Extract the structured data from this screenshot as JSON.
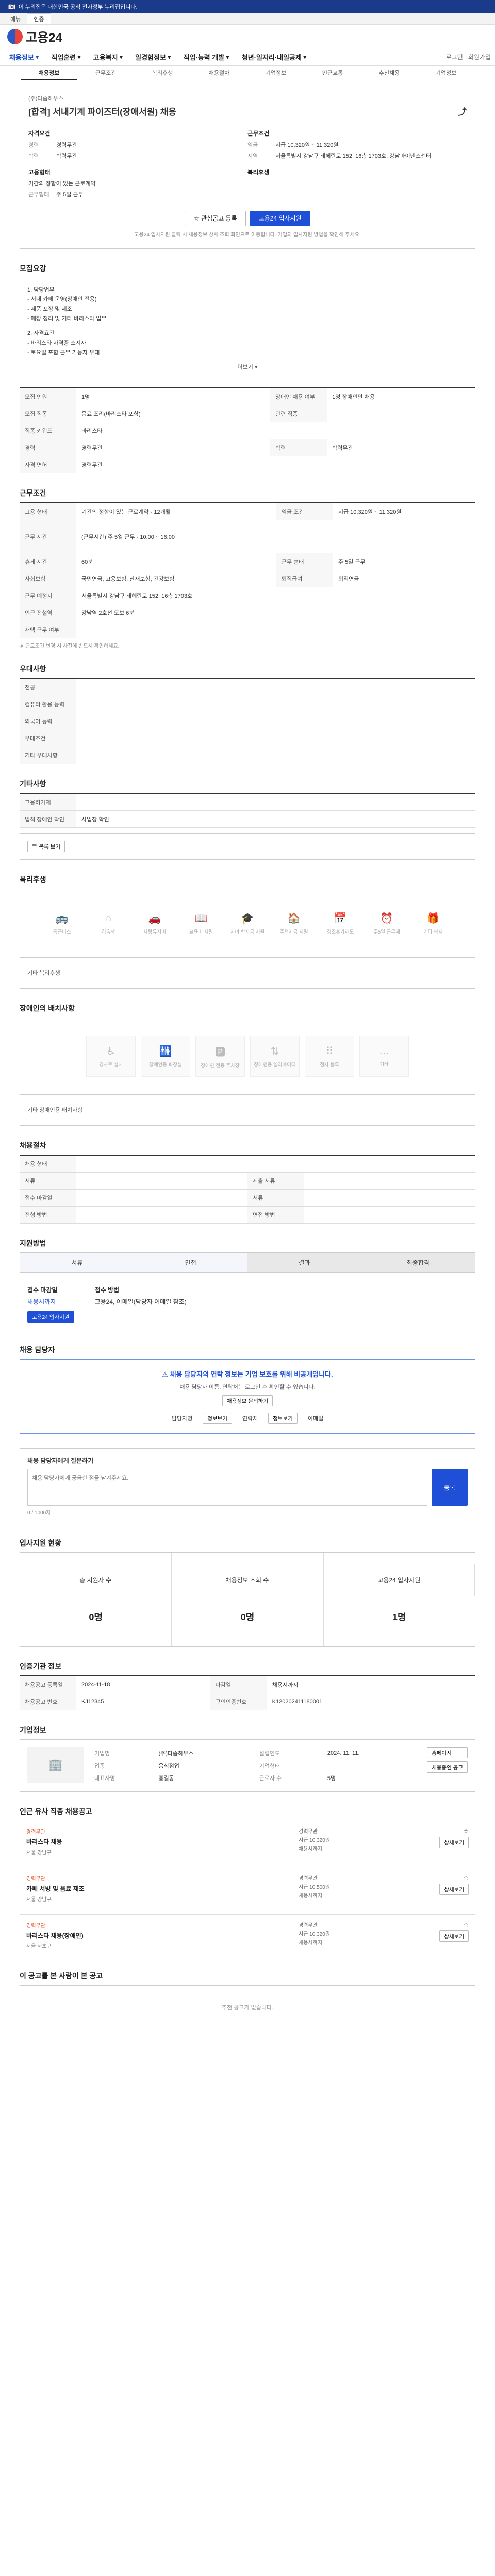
{
  "topbar": {
    "notice": "이 누리집은 대한민국 공식 전자정부 누리집입니다."
  },
  "langbar": {
    "items": [
      "메뉴",
      "인증"
    ]
  },
  "header": {
    "logo_text": "고용24"
  },
  "gnb": {
    "items": [
      "채용정보",
      "직업훈련",
      "고용복지",
      "일경험정보",
      "직업·능력 개발",
      "청년·일자리·내일공제"
    ],
    "right": [
      "로그인",
      "회원가입"
    ]
  },
  "subtabs": [
    "채용정보",
    "근무조건",
    "복리후생",
    "채용절차",
    "기업정보",
    "인근교통",
    "추천채용",
    "기업정보"
  ],
  "job": {
    "company": "(주)다솜하우스",
    "title": "[합격] 서내기계 파이즈터(장애서원) 채용",
    "apply_label": "자격요건",
    "experience_k": "경력",
    "experience_v": "경력무관",
    "education_k": "학력",
    "education_v": "학력무관",
    "cond_label": "근무조건",
    "pay_k": "임금",
    "pay_v": "시급 10,320원 ~ 11,320원",
    "place_k": "지역",
    "place_v": "서울특별시 강남구 테헤란로 152, 16층 1703호, 강남파이낸스센터",
    "hire_label": "고용형태",
    "hire_v": "기간의 정함이 있는 근로계약",
    "period_k": "근무형태",
    "period_v": "주 5일 근무",
    "welfare_label": "복리후생",
    "scrap_button": "관심공고 등록",
    "apply_button": "고용24 입사지원",
    "note": "고용24 입사지원 클릭 시 채용정보 상세 조회 화면으로 이동합니다. 기업의 입사지원 방법을 확인해 주세요."
  },
  "sections": {
    "detail_title": "모집요강",
    "detail_body": [
      "1. 담당업무",
      "- 서내 카페 운영(장애인 전용)",
      "- 제품 포장 및 제조",
      "- 매장 정리 및 기타 바리스타 업무",
      "",
      "2. 자격요건",
      "- 바리스타 자격증 소지자",
      "- 토요일 포함 근무 가능자 우대"
    ],
    "more": "더보기",
    "rows": [
      {
        "k": "모집 인원",
        "v": "1명",
        "k2": "장애인 채용 여부",
        "v2": "1명 장애인만 채용"
      },
      {
        "k": "모집 직종",
        "v": "음료 조리(바리스타 포함)",
        "k2": "관련 직종",
        "v2": ""
      },
      {
        "k": "직종 키워드",
        "v": "바리스타",
        "k2": "",
        "v2": ""
      },
      {
        "k": "경력",
        "v": "경력무관",
        "k2": "학력",
        "v2": "학력무관"
      },
      {
        "k": "자격 면허",
        "v": "경력무관",
        "k2": "",
        "v2": ""
      }
    ],
    "cond_title": "근무조건",
    "cond_rows": [
      {
        "k": "고용 형태",
        "v": "기간의 정함이 있는 근로계약 · 12개월",
        "k2": "임금 조건",
        "v2": "시급 10,320원 ~ 11,320원"
      },
      {
        "k": "근무 시간",
        "v": "(근무시간) 주 5일 근무 · 10:00 ~ 16:00",
        "k2": "",
        "v2": ""
      },
      {
        "k": "휴게 시간",
        "v": "60분",
        "k2": "근무 형태",
        "v2": "주 5일 근무"
      },
      {
        "k": "사회보험",
        "v": "국민연금, 고용보험, 산재보험, 건강보험",
        "k2": "퇴직급여",
        "v2": "퇴직연금"
      },
      {
        "k": "근무 예정지",
        "v": "서울특별시 강남구 테헤란로 152, 16층 1703호",
        "k2": "",
        "v2": ""
      },
      {
        "k": "인근 전철역",
        "v": "강남역 2호선 도보 6분",
        "k2": "",
        "v2": ""
      },
      {
        "k": "재택 근무 여부",
        "v": "",
        "k2": "",
        "v2": ""
      }
    ],
    "cond_note": "※ 근로조건 변경 시 사전에 반드시 확인하세요.",
    "barrier_title": "우대사항",
    "barrier_rows": [
      {
        "k": "전공",
        "v": ""
      },
      {
        "k": "컴퓨터 활용 능력",
        "v": ""
      },
      {
        "k": "외국어 능력",
        "v": ""
      },
      {
        "k": "우대조건",
        "v": ""
      },
      {
        "k": "기타 우대사항",
        "v": ""
      }
    ],
    "etc_title": "기타사항",
    "etc_rows": [
      {
        "k": "고용허가제",
        "v": ""
      },
      {
        "k": "법적 장애인 확인",
        "v": "사업장 확인"
      }
    ],
    "etc_button": "목록 보기",
    "welfare_title": "복리후생",
    "welfare_icons": [
      "통근버스",
      "기숙사",
      "차량유지비",
      "교육비 지원",
      "자녀 학자금 지원",
      "주택자금 지원",
      "경조휴가제도",
      "주5일 근무제",
      "기타 복지"
    ],
    "welfare_etc": "기타 복리후생",
    "disabled_title": "장애인의 배치사항",
    "disabled_icons": [
      "경사로 설치",
      "장애인용 화장실",
      "장애인 전용 주차장",
      "장애인용 엘리베이터",
      "점자 블록",
      "기타"
    ],
    "disabled_etc": "기타 장애인용 배치사항",
    "process_title": "채용절차",
    "process_rows": [
      {
        "k": "채용 형태",
        "v": ""
      },
      {
        "k": "서류",
        "v": "",
        "k2": "제출 서류",
        "v2": ""
      },
      {
        "k": "접수 마감일",
        "v": "",
        "k2": "서류",
        "v2": ""
      },
      {
        "k": "전형 방법",
        "v": "",
        "k2": "면접 방법",
        "v2": ""
      }
    ],
    "apply_title": "지원방법",
    "apply_steps": [
      "서류",
      "면접",
      "결과",
      "최종합격"
    ],
    "apply_info_k": "접수 마감일",
    "apply_info_v": "채용시까지",
    "apply_method_k": "접수 방법",
    "apply_method_v": "고용24, 이메일(담당자 이메일 참조)",
    "apply_btn": "고용24 입사지원",
    "notice_title": "채용 담당자",
    "notice_hl": "채용 담당자의 연락 정보는 기업 보호를 위해 비공개입니다.",
    "notice_body": "채용 담당자 이름, 연락처는 로그인 후 확인할 수 있습니다.",
    "notice_btn": "채용정보 문의하기",
    "contact_labels": [
      "담당자명",
      "연락처",
      "이메일"
    ],
    "contact_btns": [
      "정보보기",
      "정보보기"
    ],
    "qna_title": "채용 담당자에게 질문하기",
    "qna_placeholder": "채용 담당자에게 궁금한 점을 남겨주세요.",
    "qna_count": "0 / 1000자",
    "qna_btn": "등록",
    "stats_title": "입사지원 현황",
    "stats": [
      {
        "k": "총 지원자 수",
        "v": "0명"
      },
      {
        "k": "채용정보 조회 수",
        "v": "0명"
      },
      {
        "k": "고용24 입사지원",
        "v": "1명"
      }
    ],
    "info_title": "인증기관 정보",
    "info_rows": [
      {
        "k": "채용공고 등록일",
        "v": "2024-11-18",
        "k2": "마감일",
        "v2": "채용시까지"
      },
      {
        "k": "채용공고 번호",
        "v": "KJ12345",
        "k2": "구인인증번호",
        "v2": "K120202411180001"
      }
    ],
    "company_title": "기업정보",
    "company_rows": [
      {
        "k": "기업명",
        "v": "(주)다솜하우스",
        "k2": "설립연도",
        "v2": "2024. 11. 11."
      },
      {
        "k": "업종",
        "v": "음식점업",
        "k2": "기업형태",
        "v2": ""
      },
      {
        "k": "대표자명",
        "v": "홍길동",
        "k2": "근로자 수",
        "v2": "5명"
      }
    ],
    "company_btns": [
      "홈페이지",
      "채용중인 공고"
    ],
    "similar_title": "인근 유사 직종 채용공고",
    "similar_jobs": [
      {
        "tag": "경력무관",
        "title": "바리스타 채용",
        "desc": "서울 강남구",
        "meta": [
          "경력무관",
          "시급 10,320원",
          "채용시까지"
        ]
      },
      {
        "tag": "경력무관",
        "title": "카페 서빙 및 음료 제조",
        "desc": "서울 강남구",
        "meta": [
          "경력무관",
          "시급 10,500원",
          "채용시까지"
        ]
      },
      {
        "tag": "경력무관",
        "title": "바리스타 채용(장애인)",
        "desc": "서울 서초구",
        "meta": [
          "경력무관",
          "시급 10,320원",
          "채용시까지"
        ]
      }
    ],
    "similar_btn": "상세보기",
    "recommend_title": "이 공고를 본 사람이 본 공고",
    "recommend_empty": "추천 공고가 없습니다."
  }
}
